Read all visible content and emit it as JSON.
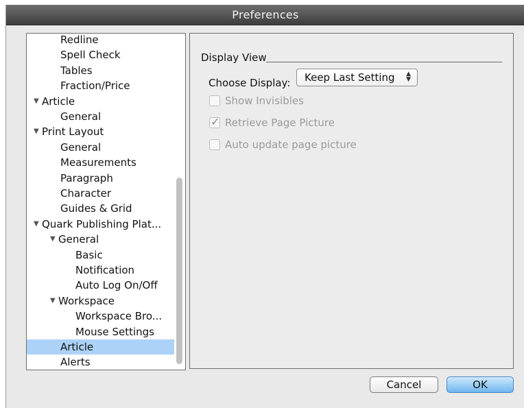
{
  "window": {
    "title": "Preferences"
  },
  "tree": {
    "items": [
      {
        "label": "Redline",
        "level": 2,
        "expandable": false,
        "selected": false
      },
      {
        "label": "Spell Check",
        "level": 2,
        "expandable": false,
        "selected": false
      },
      {
        "label": "Tables",
        "level": 2,
        "expandable": false,
        "selected": false
      },
      {
        "label": "Fraction/Price",
        "level": 2,
        "expandable": false,
        "selected": false
      },
      {
        "label": "Article",
        "level": 1,
        "expandable": true,
        "selected": false
      },
      {
        "label": "General",
        "level": 2,
        "expandable": false,
        "selected": false
      },
      {
        "label": "Print Layout",
        "level": 1,
        "expandable": true,
        "selected": false
      },
      {
        "label": "General",
        "level": 2,
        "expandable": false,
        "selected": false
      },
      {
        "label": "Measurements",
        "level": 2,
        "expandable": false,
        "selected": false
      },
      {
        "label": "Paragraph",
        "level": 2,
        "expandable": false,
        "selected": false
      },
      {
        "label": "Character",
        "level": 2,
        "expandable": false,
        "selected": false
      },
      {
        "label": "Guides & Grid",
        "level": 2,
        "expandable": false,
        "selected": false
      },
      {
        "label": "Quark Publishing Plat...",
        "level": 1,
        "expandable": true,
        "selected": false
      },
      {
        "label": "General",
        "level": 2,
        "expandable": true,
        "selected": false
      },
      {
        "label": "Basic",
        "level": 3,
        "expandable": false,
        "selected": false
      },
      {
        "label": "Notification",
        "level": 3,
        "expandable": false,
        "selected": false
      },
      {
        "label": "Auto Log On/Off",
        "level": 3,
        "expandable": false,
        "selected": false
      },
      {
        "label": "Workspace",
        "level": 2,
        "expandable": true,
        "selected": false
      },
      {
        "label": "Workspace Bro...",
        "level": 3,
        "expandable": false,
        "selected": false
      },
      {
        "label": "Mouse Settings",
        "level": 3,
        "expandable": false,
        "selected": false
      },
      {
        "label": "Article",
        "level": 2,
        "expandable": false,
        "selected": true
      },
      {
        "label": "Alerts",
        "level": 2,
        "expandable": false,
        "selected": false
      }
    ]
  },
  "content": {
    "section_title": "Display View",
    "choose_display_label": "Choose Display:",
    "choose_display_value": "Keep Last Setting",
    "checkboxes": [
      {
        "label": "Show Invisibles",
        "checked": false,
        "enabled": false
      },
      {
        "label": "Retrieve Page Picture",
        "checked": true,
        "enabled": false
      },
      {
        "label": "Auto update page picture",
        "checked": false,
        "enabled": false
      }
    ]
  },
  "buttons": {
    "cancel": "Cancel",
    "ok": "OK"
  },
  "colors": {
    "selection": "#acd2f8",
    "ok_button": "#6fb6ef",
    "titlebar": "#4f4f4f"
  }
}
